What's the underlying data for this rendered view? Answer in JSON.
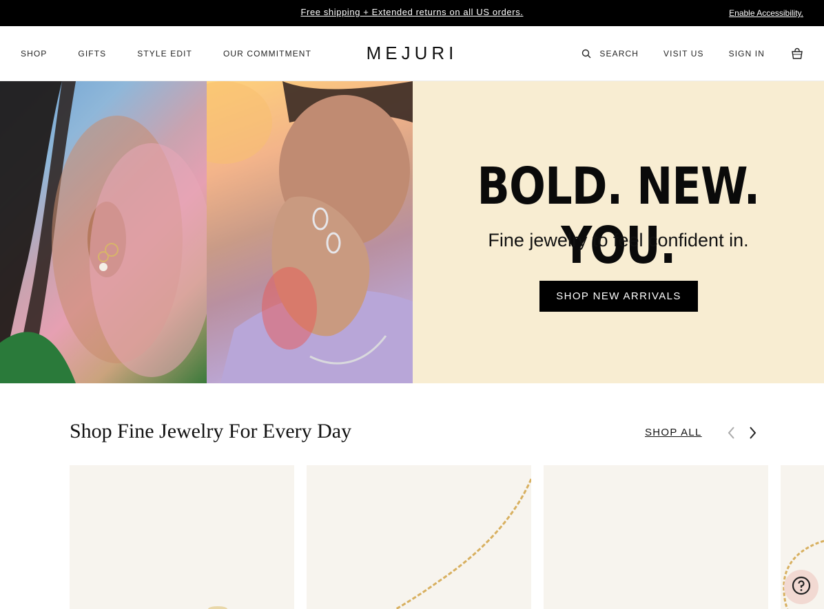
{
  "announcement": {
    "promo": "Free shipping + Extended returns on all US orders.",
    "accessibility": "Enable Accessibility."
  },
  "header": {
    "logo": "MEJURI",
    "nav_left": [
      "SHOP",
      "GIFTS",
      "STYLE EDIT",
      "OUR COMMITMENT"
    ],
    "search_label": "SEARCH",
    "visit_label": "VISIT US",
    "signin_label": "SIGN IN"
  },
  "hero": {
    "title": "BOLD. NEW. YOU.",
    "subtitle": "Fine jewelry to feel confident in.",
    "cta": "SHOP NEW ARRIVALS"
  },
  "section": {
    "title": "Shop Fine Jewelry For Every Day",
    "shop_all": "SHOP ALL"
  },
  "icons": {
    "search": "search-icon",
    "bag": "shopping-bag-icon",
    "prev": "chevron-left-icon",
    "next": "chevron-right-icon",
    "help": "help-icon"
  },
  "colors": {
    "announcement_bg": "#000000",
    "hero_panel_bg": "#f8edd2",
    "cta_bg": "#000000",
    "product_bg": "#f7f4ee",
    "help_bg": "#f2d9d2"
  }
}
